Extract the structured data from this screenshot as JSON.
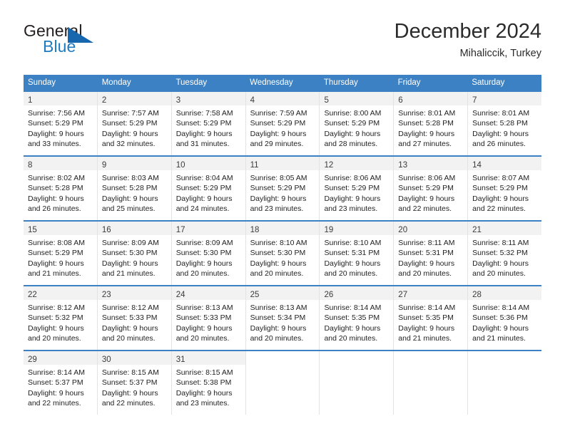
{
  "brand": {
    "name_part1": "General",
    "name_part2": "Blue",
    "triangle_color": "#1667ae",
    "blue_color": "#1f7bc1"
  },
  "header": {
    "title": "December 2024",
    "subtitle": "Mihaliccik, Turkey"
  },
  "theme": {
    "header_blue": "#3c81c3",
    "daynum_band": "#f2f2f2",
    "cell_border": "#e3e3e3"
  },
  "weekdays": [
    "Sunday",
    "Monday",
    "Tuesday",
    "Wednesday",
    "Thursday",
    "Friday",
    "Saturday"
  ],
  "weeks": [
    {
      "days": [
        {
          "day": "1",
          "sunrise": "Sunrise: 7:56 AM",
          "sunset": "Sunset: 5:29 PM",
          "daylight1": "Daylight: 9 hours",
          "daylight2": "and 33 minutes."
        },
        {
          "day": "2",
          "sunrise": "Sunrise: 7:57 AM",
          "sunset": "Sunset: 5:29 PM",
          "daylight1": "Daylight: 9 hours",
          "daylight2": "and 32 minutes."
        },
        {
          "day": "3",
          "sunrise": "Sunrise: 7:58 AM",
          "sunset": "Sunset: 5:29 PM",
          "daylight1": "Daylight: 9 hours",
          "daylight2": "and 31 minutes."
        },
        {
          "day": "4",
          "sunrise": "Sunrise: 7:59 AM",
          "sunset": "Sunset: 5:29 PM",
          "daylight1": "Daylight: 9 hours",
          "daylight2": "and 29 minutes."
        },
        {
          "day": "5",
          "sunrise": "Sunrise: 8:00 AM",
          "sunset": "Sunset: 5:29 PM",
          "daylight1": "Daylight: 9 hours",
          "daylight2": "and 28 minutes."
        },
        {
          "day": "6",
          "sunrise": "Sunrise: 8:01 AM",
          "sunset": "Sunset: 5:28 PM",
          "daylight1": "Daylight: 9 hours",
          "daylight2": "and 27 minutes."
        },
        {
          "day": "7",
          "sunrise": "Sunrise: 8:01 AM",
          "sunset": "Sunset: 5:28 PM",
          "daylight1": "Daylight: 9 hours",
          "daylight2": "and 26 minutes."
        }
      ]
    },
    {
      "days": [
        {
          "day": "8",
          "sunrise": "Sunrise: 8:02 AM",
          "sunset": "Sunset: 5:28 PM",
          "daylight1": "Daylight: 9 hours",
          "daylight2": "and 26 minutes."
        },
        {
          "day": "9",
          "sunrise": "Sunrise: 8:03 AM",
          "sunset": "Sunset: 5:28 PM",
          "daylight1": "Daylight: 9 hours",
          "daylight2": "and 25 minutes."
        },
        {
          "day": "10",
          "sunrise": "Sunrise: 8:04 AM",
          "sunset": "Sunset: 5:29 PM",
          "daylight1": "Daylight: 9 hours",
          "daylight2": "and 24 minutes."
        },
        {
          "day": "11",
          "sunrise": "Sunrise: 8:05 AM",
          "sunset": "Sunset: 5:29 PM",
          "daylight1": "Daylight: 9 hours",
          "daylight2": "and 23 minutes."
        },
        {
          "day": "12",
          "sunrise": "Sunrise: 8:06 AM",
          "sunset": "Sunset: 5:29 PM",
          "daylight1": "Daylight: 9 hours",
          "daylight2": "and 23 minutes."
        },
        {
          "day": "13",
          "sunrise": "Sunrise: 8:06 AM",
          "sunset": "Sunset: 5:29 PM",
          "daylight1": "Daylight: 9 hours",
          "daylight2": "and 22 minutes."
        },
        {
          "day": "14",
          "sunrise": "Sunrise: 8:07 AM",
          "sunset": "Sunset: 5:29 PM",
          "daylight1": "Daylight: 9 hours",
          "daylight2": "and 22 minutes."
        }
      ]
    },
    {
      "days": [
        {
          "day": "15",
          "sunrise": "Sunrise: 8:08 AM",
          "sunset": "Sunset: 5:29 PM",
          "daylight1": "Daylight: 9 hours",
          "daylight2": "and 21 minutes."
        },
        {
          "day": "16",
          "sunrise": "Sunrise: 8:09 AM",
          "sunset": "Sunset: 5:30 PM",
          "daylight1": "Daylight: 9 hours",
          "daylight2": "and 21 minutes."
        },
        {
          "day": "17",
          "sunrise": "Sunrise: 8:09 AM",
          "sunset": "Sunset: 5:30 PM",
          "daylight1": "Daylight: 9 hours",
          "daylight2": "and 20 minutes."
        },
        {
          "day": "18",
          "sunrise": "Sunrise: 8:10 AM",
          "sunset": "Sunset: 5:30 PM",
          "daylight1": "Daylight: 9 hours",
          "daylight2": "and 20 minutes."
        },
        {
          "day": "19",
          "sunrise": "Sunrise: 8:10 AM",
          "sunset": "Sunset: 5:31 PM",
          "daylight1": "Daylight: 9 hours",
          "daylight2": "and 20 minutes."
        },
        {
          "day": "20",
          "sunrise": "Sunrise: 8:11 AM",
          "sunset": "Sunset: 5:31 PM",
          "daylight1": "Daylight: 9 hours",
          "daylight2": "and 20 minutes."
        },
        {
          "day": "21",
          "sunrise": "Sunrise: 8:11 AM",
          "sunset": "Sunset: 5:32 PM",
          "daylight1": "Daylight: 9 hours",
          "daylight2": "and 20 minutes."
        }
      ]
    },
    {
      "days": [
        {
          "day": "22",
          "sunrise": "Sunrise: 8:12 AM",
          "sunset": "Sunset: 5:32 PM",
          "daylight1": "Daylight: 9 hours",
          "daylight2": "and 20 minutes."
        },
        {
          "day": "23",
          "sunrise": "Sunrise: 8:12 AM",
          "sunset": "Sunset: 5:33 PM",
          "daylight1": "Daylight: 9 hours",
          "daylight2": "and 20 minutes."
        },
        {
          "day": "24",
          "sunrise": "Sunrise: 8:13 AM",
          "sunset": "Sunset: 5:33 PM",
          "daylight1": "Daylight: 9 hours",
          "daylight2": "and 20 minutes."
        },
        {
          "day": "25",
          "sunrise": "Sunrise: 8:13 AM",
          "sunset": "Sunset: 5:34 PM",
          "daylight1": "Daylight: 9 hours",
          "daylight2": "and 20 minutes."
        },
        {
          "day": "26",
          "sunrise": "Sunrise: 8:14 AM",
          "sunset": "Sunset: 5:35 PM",
          "daylight1": "Daylight: 9 hours",
          "daylight2": "and 20 minutes."
        },
        {
          "day": "27",
          "sunrise": "Sunrise: 8:14 AM",
          "sunset": "Sunset: 5:35 PM",
          "daylight1": "Daylight: 9 hours",
          "daylight2": "and 21 minutes."
        },
        {
          "day": "28",
          "sunrise": "Sunrise: 8:14 AM",
          "sunset": "Sunset: 5:36 PM",
          "daylight1": "Daylight: 9 hours",
          "daylight2": "and 21 minutes."
        }
      ]
    },
    {
      "days": [
        {
          "day": "29",
          "sunrise": "Sunrise: 8:14 AM",
          "sunset": "Sunset: 5:37 PM",
          "daylight1": "Daylight: 9 hours",
          "daylight2": "and 22 minutes."
        },
        {
          "day": "30",
          "sunrise": "Sunrise: 8:15 AM",
          "sunset": "Sunset: 5:37 PM",
          "daylight1": "Daylight: 9 hours",
          "daylight2": "and 22 minutes."
        },
        {
          "day": "31",
          "sunrise": "Sunrise: 8:15 AM",
          "sunset": "Sunset: 5:38 PM",
          "daylight1": "Daylight: 9 hours",
          "daylight2": "and 23 minutes."
        },
        {
          "day": "",
          "sunrise": "",
          "sunset": "",
          "daylight1": "",
          "daylight2": ""
        },
        {
          "day": "",
          "sunrise": "",
          "sunset": "",
          "daylight1": "",
          "daylight2": ""
        },
        {
          "day": "",
          "sunrise": "",
          "sunset": "",
          "daylight1": "",
          "daylight2": ""
        },
        {
          "day": "",
          "sunrise": "",
          "sunset": "",
          "daylight1": "",
          "daylight2": ""
        }
      ]
    }
  ]
}
